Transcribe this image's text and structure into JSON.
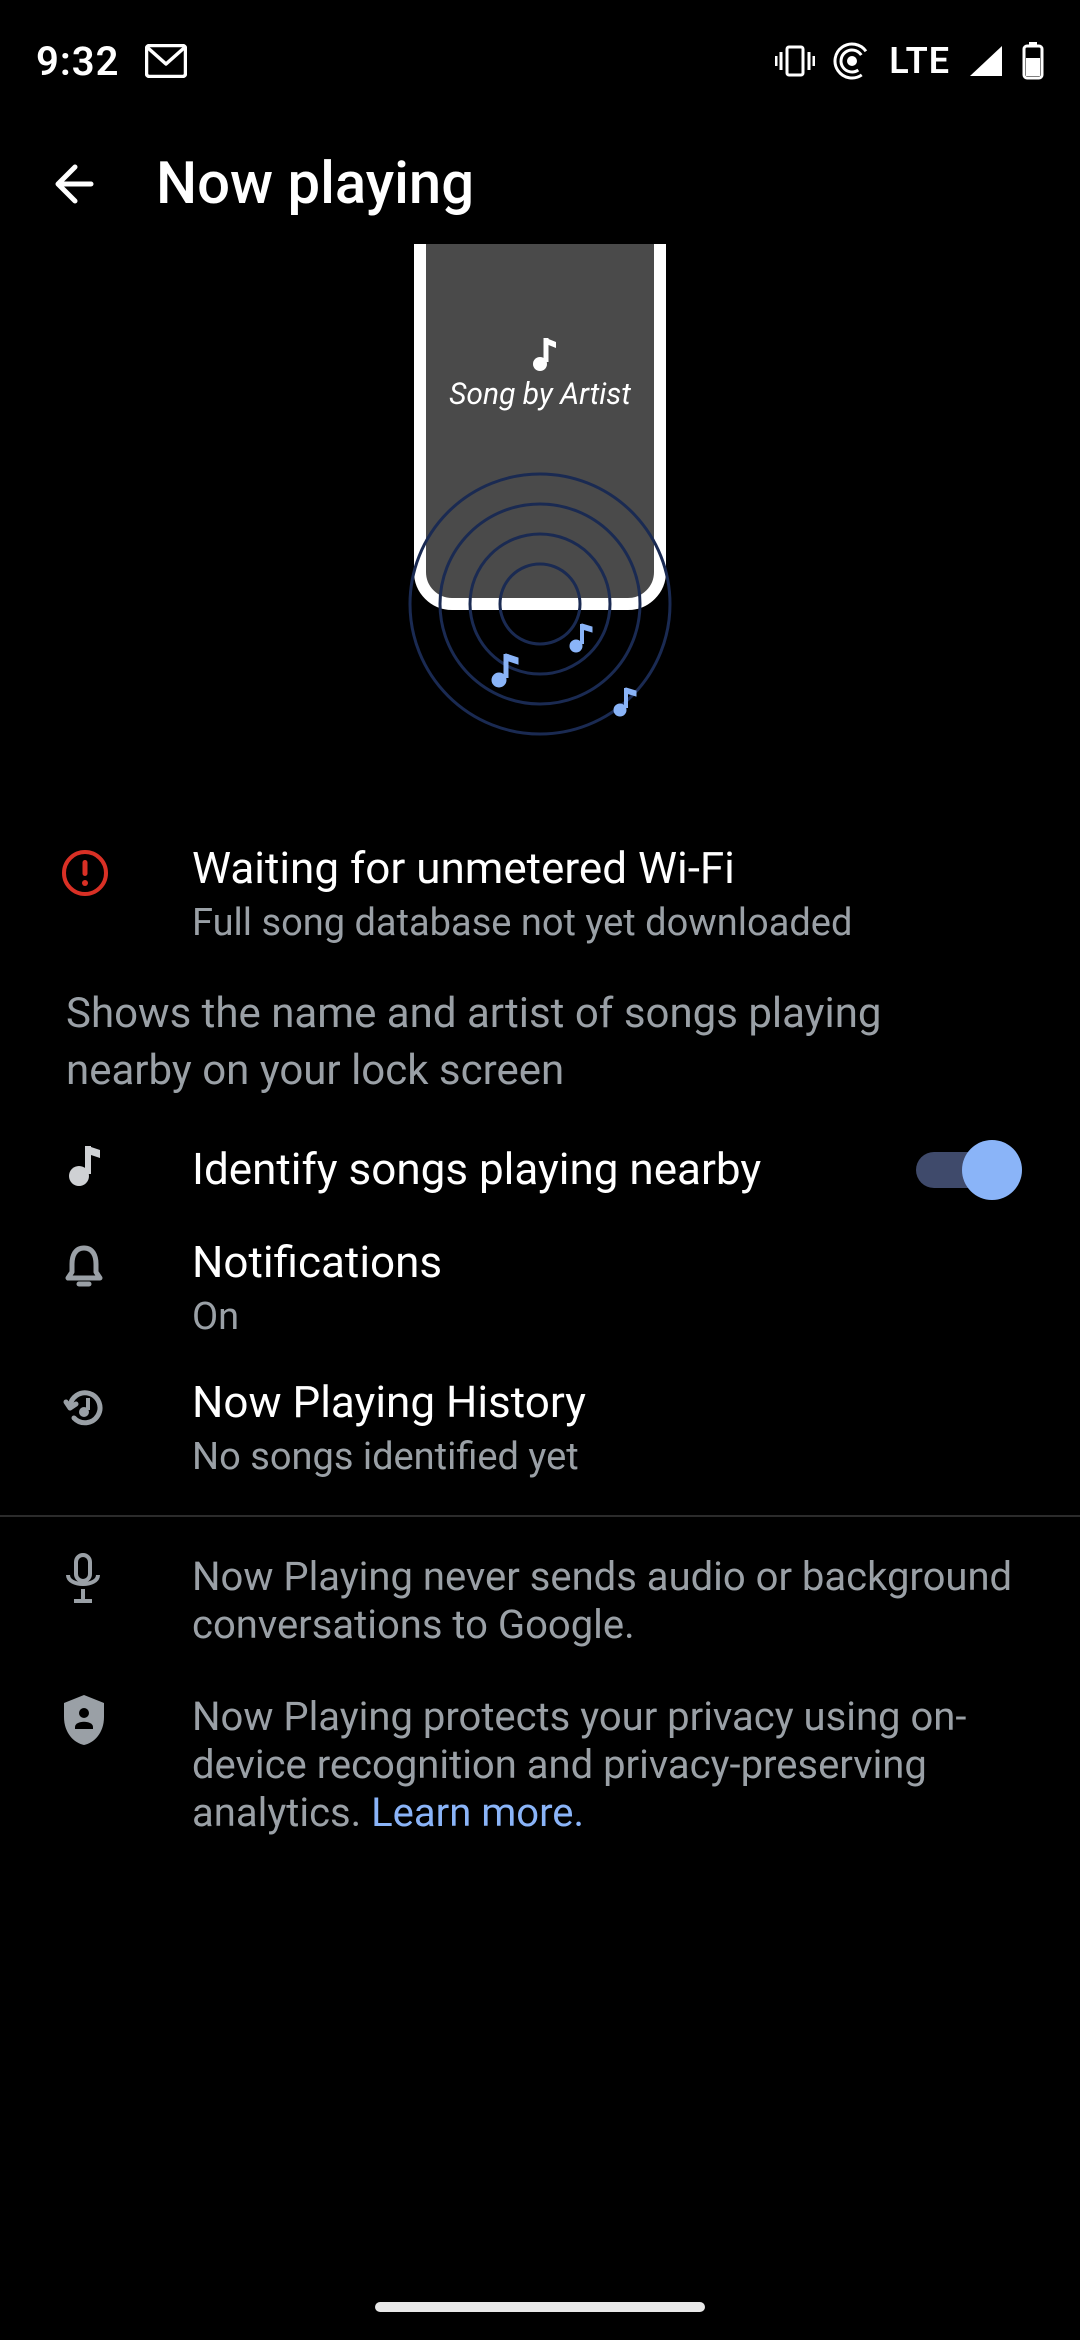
{
  "status": {
    "time": "9:32",
    "network_label": "LTE"
  },
  "header": {
    "title": "Now playing"
  },
  "hero": {
    "caption": "Song by Artist"
  },
  "warning": {
    "title": "Waiting for unmetered Wi-Fi",
    "subtitle": "Full song database not yet downloaded"
  },
  "description": "Shows the name and artist of songs playing nearby on your lock screen",
  "identify": {
    "title": "Identify songs playing nearby",
    "enabled": true
  },
  "notifications": {
    "title": "Notifications",
    "status": "On"
  },
  "history": {
    "title": "Now Playing History",
    "subtitle": "No songs identified yet"
  },
  "info": {
    "privacy_audio": "Now Playing never sends audio or background conversations to Google.",
    "privacy_shield": "Now Playing protects your privacy using on-device recognition and privacy-preserving analytics. ",
    "learn_more": "Learn more."
  }
}
